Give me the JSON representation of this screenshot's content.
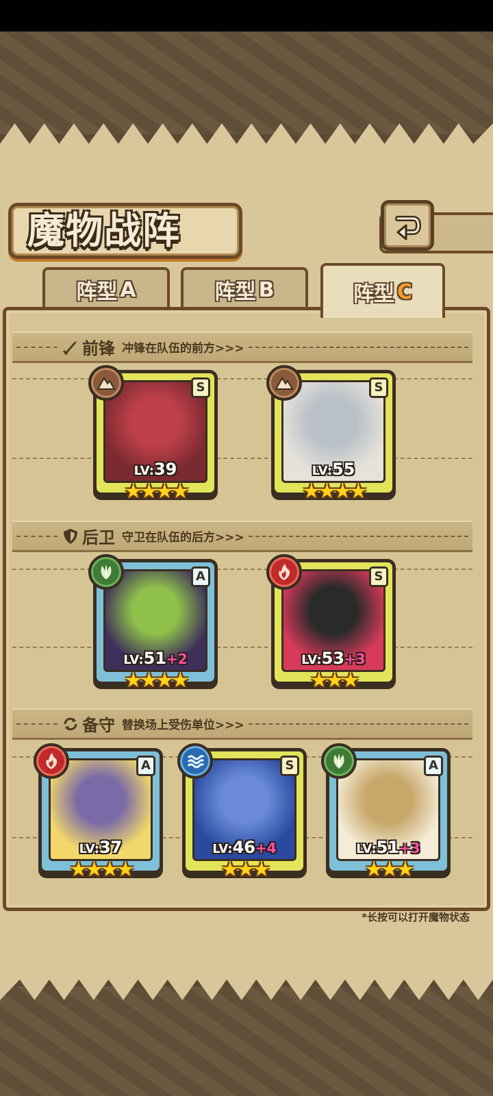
{
  "title": "魔物战阵",
  "tabs": [
    {
      "label": "阵型",
      "letter": "A"
    },
    {
      "label": "阵型",
      "letter": "B"
    },
    {
      "label": "阵型",
      "letter": "C"
    }
  ],
  "active_tab": 2,
  "sections": {
    "front": {
      "title": "前锋",
      "desc": "冲锋在队伍的前方>>>"
    },
    "back": {
      "title": "后卫",
      "desc": "守卫在队伍的后方>>>"
    },
    "reserve": {
      "title": "备守",
      "desc": "替换场上受伤单位>>>"
    }
  },
  "cards": [
    {
      "rank": "S",
      "element": "earth",
      "lv_prefix": "LV:",
      "level": "39",
      "bonus": "",
      "stars": "★★★★",
      "art": [
        "#7a2a30",
        "#c0404a"
      ]
    },
    {
      "rank": "S",
      "element": "earth",
      "lv_prefix": "LV:",
      "level": "55",
      "bonus": "",
      "stars": "★★★★",
      "art": [
        "#e6e2da",
        "#b9c0c8"
      ]
    },
    {
      "rank": "A",
      "element": "wood",
      "lv_prefix": "LV:",
      "level": "51",
      "bonus": "+2",
      "stars": "★★★★",
      "art": [
        "#3e2f5a",
        "#8ec04a"
      ]
    },
    {
      "rank": "S",
      "element": "fire",
      "lv_prefix": "LV:",
      "level": "53",
      "bonus": "+3",
      "stars": "★★★",
      "art": [
        "#d83a5a",
        "#2a2a2a"
      ]
    },
    {
      "rank": "A",
      "element": "fire",
      "lv_prefix": "LV:",
      "level": "37",
      "bonus": "",
      "stars": "★★★★",
      "art": [
        "#f2d86a",
        "#7a6aa8"
      ]
    },
    {
      "rank": "S",
      "element": "water",
      "lv_prefix": "LV:",
      "level": "46",
      "bonus": "+4",
      "stars": "★★★",
      "art": [
        "#2a4aa0",
        "#6a8ad8"
      ]
    },
    {
      "rank": "A",
      "element": "wood",
      "lv_prefix": "LV:",
      "level": "51",
      "bonus": "+3",
      "stars": "★★★",
      "art": [
        "#f4ecd6",
        "#c8a86a"
      ]
    }
  ],
  "footnote": "*长按可以打开魔物状态",
  "icons": {
    "back": "return-arrow-icon",
    "front": "sword-icon",
    "back_section": "shield-icon",
    "reserve": "swap-icon",
    "earth": "earth-element-icon",
    "wood": "leaf-element-icon",
    "fire": "fire-element-icon",
    "water": "water-element-icon"
  }
}
